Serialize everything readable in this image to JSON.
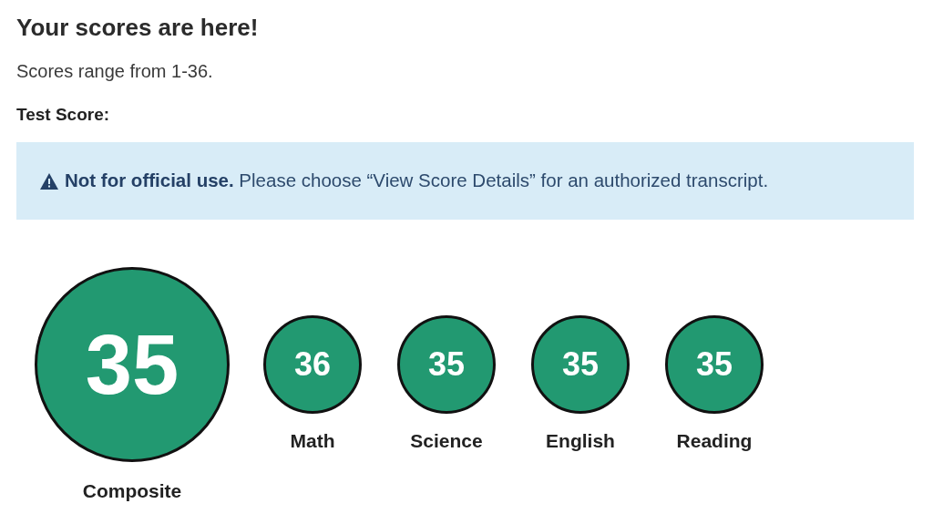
{
  "heading": "Your scores are here!",
  "subtitle": "Scores range from 1-36.",
  "section_label": "Test Score:",
  "alert": {
    "text": "**Not for official use.** Please choose “View Score Details” for an authorized transcript."
  },
  "composite": {
    "score": "35",
    "label": "Composite"
  },
  "subscores": [
    {
      "score": "36",
      "label": "Math"
    },
    {
      "score": "35",
      "label": "Science"
    },
    {
      "score": "35",
      "label": "English"
    },
    {
      "score": "35",
      "label": "Reading"
    }
  ]
}
